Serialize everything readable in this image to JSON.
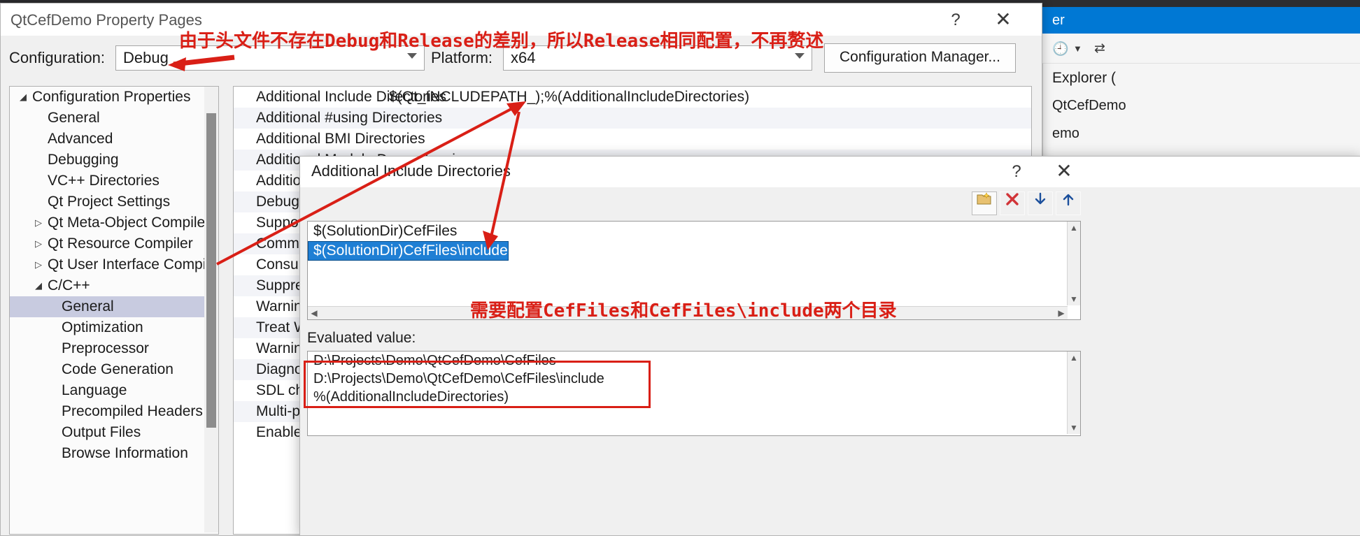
{
  "window": {
    "title": "QtCefDemo Property Pages",
    "help_icon": "?",
    "close_icon": "✕"
  },
  "config_bar": {
    "configuration_label": "Configuration:",
    "configuration_value": "Debug",
    "platform_label": "Platform:",
    "platform_value": "x64",
    "configuration_manager_button": "Configuration Manager...",
    "dropdown_icon": "chevron-down-icon"
  },
  "tree": {
    "items": [
      {
        "label": "Configuration Properties",
        "depth": 0,
        "twisty": "▲",
        "selected": false
      },
      {
        "label": "General",
        "depth": 1,
        "twisty": "",
        "selected": false
      },
      {
        "label": "Advanced",
        "depth": 1,
        "twisty": "",
        "selected": false
      },
      {
        "label": "Debugging",
        "depth": 1,
        "twisty": "",
        "selected": false
      },
      {
        "label": "VC++ Directories",
        "depth": 1,
        "twisty": "",
        "selected": false
      },
      {
        "label": "Qt Project Settings",
        "depth": 1,
        "twisty": "",
        "selected": false
      },
      {
        "label": "Qt Meta-Object Compiler",
        "depth": 1,
        "twisty": "▷",
        "selected": false
      },
      {
        "label": "Qt Resource Compiler",
        "depth": 1,
        "twisty": "▷",
        "selected": false
      },
      {
        "label": "Qt User Interface Compiler",
        "depth": 1,
        "twisty": "▷",
        "selected": false
      },
      {
        "label": "C/C++",
        "depth": 1,
        "twisty": "▲",
        "selected": false
      },
      {
        "label": "General",
        "depth": 2,
        "twisty": "",
        "selected": true
      },
      {
        "label": "Optimization",
        "depth": 2,
        "twisty": "",
        "selected": false
      },
      {
        "label": "Preprocessor",
        "depth": 2,
        "twisty": "",
        "selected": false
      },
      {
        "label": "Code Generation",
        "depth": 2,
        "twisty": "",
        "selected": false
      },
      {
        "label": "Language",
        "depth": 2,
        "twisty": "",
        "selected": false
      },
      {
        "label": "Precompiled Headers",
        "depth": 2,
        "twisty": "",
        "selected": false
      },
      {
        "label": "Output Files",
        "depth": 2,
        "twisty": "",
        "selected": false
      },
      {
        "label": "Browse Information",
        "depth": 2,
        "twisty": "",
        "selected": false
      }
    ]
  },
  "grid": {
    "rows": [
      {
        "name": "Additional Include Directories",
        "value": "$(Qt_INCLUDEPATH_);%(AdditionalIncludeDirectories)"
      },
      {
        "name": "Additional #using Directories",
        "value": ""
      },
      {
        "name": "Additional BMI Directories",
        "value": ""
      },
      {
        "name": "Additional Module Dependencies",
        "value": ""
      },
      {
        "name": "Additional Header Unit Dependencies",
        "value": ""
      },
      {
        "name": "Debug Information Format",
        "value": ""
      },
      {
        "name": "Support Just My Code Debugging",
        "value": ""
      },
      {
        "name": "Common Language RunTime Support",
        "value": ""
      },
      {
        "name": "Consume Windows Runtime Extension",
        "value": ""
      },
      {
        "name": "Suppress Startup Banner",
        "value": ""
      },
      {
        "name": "Warning Level",
        "value": ""
      },
      {
        "name": "Treat Warnings As Errors",
        "value": ""
      },
      {
        "name": "Warning Version",
        "value": ""
      },
      {
        "name": "Diagnostics Format",
        "value": ""
      },
      {
        "name": "SDL checks",
        "value": ""
      },
      {
        "name": "Multi-processor Compilation",
        "value": ""
      },
      {
        "name": "Enable Address Sanitizer",
        "value": ""
      }
    ]
  },
  "aid_dialog": {
    "title": "Additional Include Directories",
    "help_icon": "?",
    "close_icon": "✕",
    "toolbar": {
      "new_line_label": "new-folder-icon",
      "delete_label": "✕",
      "move_down_label": "↓",
      "move_up_label": "↑"
    },
    "entries": [
      {
        "text": "$(SolutionDir)CefFiles",
        "selected": false
      },
      {
        "text": "$(SolutionDir)CefFiles\\include",
        "selected": true
      }
    ],
    "evaluated_label": "Evaluated value:",
    "evaluated_lines": [
      "D:\\Projects\\Demo\\QtCefDemo\\CefFiles",
      "D:\\Projects\\Demo\\QtCefDemo\\CefFiles\\include",
      "%(AdditionalIncludeDirectories)"
    ],
    "scroll_left_icon": "◀",
    "scroll_right_icon": "▶",
    "scroll_up_icon": "▲",
    "scroll_down_icon": "▼"
  },
  "annotations": {
    "top_note": "由于头文件不存在Debug和Release的差别，所以Release相同配置，不再赘述",
    "middle_note": "需要配置CefFiles和CefFiles\\include两个目录",
    "color": "#d91f16"
  },
  "vs_background": {
    "tab_label": "er",
    "explorer_label": "Explorer (",
    "tree_lines": [
      "QtCefDemo",
      "emo"
    ],
    "history_icon": "clock-icon",
    "sync_icon": "sync-icon",
    "accent": "#0078d4"
  }
}
